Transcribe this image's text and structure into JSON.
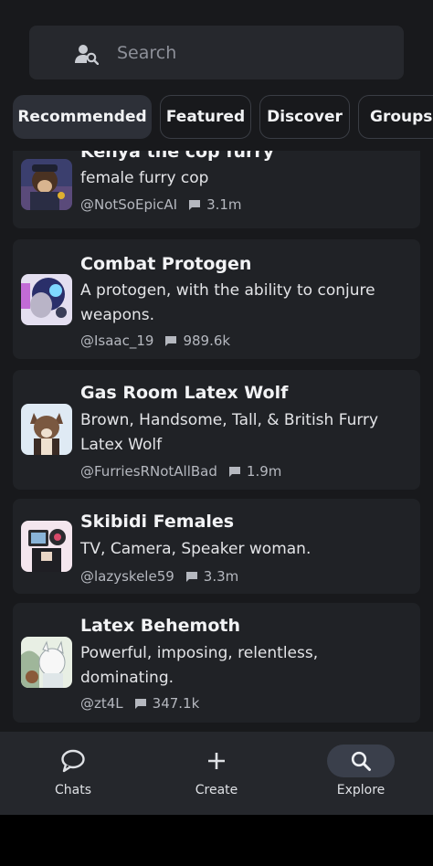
{
  "search": {
    "placeholder": "Search",
    "icon": "person-search-icon"
  },
  "tabs": [
    {
      "label": "Recommended",
      "active": true
    },
    {
      "label": "Featured",
      "active": false
    },
    {
      "label": "Discover",
      "active": false
    },
    {
      "label": "Groups",
      "active": false
    }
  ],
  "characters": [
    {
      "name": "Kenya the cop furry",
      "description": "female furry cop",
      "author": "@NotSoEpicAI",
      "chats": "3.1m"
    },
    {
      "name": "Combat Protogen",
      "description": "A protogen, with the ability to conjure weapons.",
      "author": "@Isaac_19",
      "chats": "989.6k"
    },
    {
      "name": "Gas Room Latex Wolf",
      "description": "Brown, Handsome, Tall, & British Furry Latex Wolf",
      "author": "@FurriesRNotAllBad",
      "chats": "1.9m"
    },
    {
      "name": "Skibidi Females",
      "description": "TV, Camera, Speaker woman.",
      "author": "@lazyskele59",
      "chats": "3.3m"
    },
    {
      "name": "Latex Behemoth",
      "description": "Powerful, imposing, relentless, dominating.",
      "author": "@zt4L",
      "chats": "347.1k"
    }
  ],
  "nav": [
    {
      "label": "Chats",
      "icon": "chat-bubble-icon",
      "active": false
    },
    {
      "label": "Create",
      "icon": "plus-icon",
      "active": false
    },
    {
      "label": "Explore",
      "icon": "search-icon",
      "active": true
    }
  ],
  "colors": {
    "background": "#18191c",
    "card": "#202226",
    "active_pill": "#3a3f4b"
  }
}
